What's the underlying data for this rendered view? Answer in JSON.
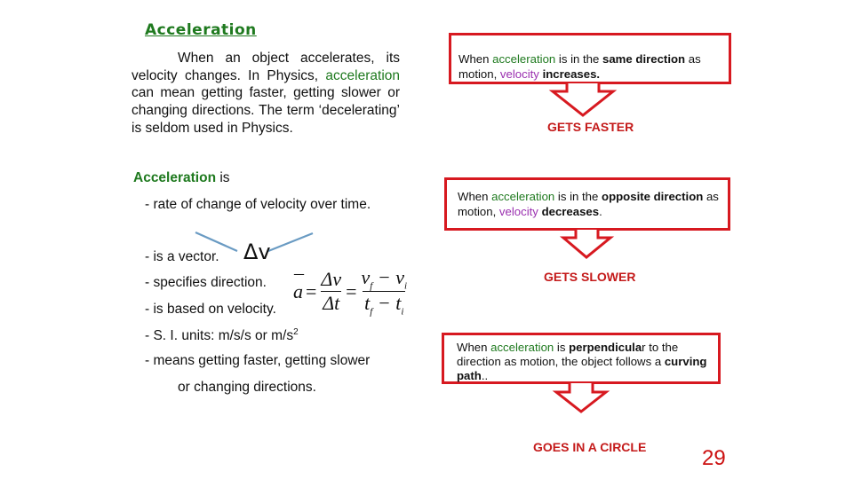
{
  "left": {
    "title": "Acceleration",
    "intro": {
      "p1": "When an object accelerates, its velocity changes. In Physics, ",
      "highlight": "acceleration",
      "p2": " can mean getting faster, getting slower or changing directions. The term ‘decelerating’ is seldom used in Physics."
    },
    "definition": {
      "head_green": "Acceleration",
      "head_rest": " is",
      "bullets": [
        "- rate of change of velocity over time.",
        "- is a vector.",
        "- specifies direction.",
        "- is based on velocity.",
        "- S. I. units:  m/s/s or m/s",
        "- means getting faster, getting slower",
        "or changing directions."
      ],
      "units_superscript": "2",
      "delta_v": "Δv",
      "formula": {
        "lhs": "a",
        "num1": "Δv",
        "den1": "Δt",
        "num2": "v",
        "num2_sub_f": "f",
        "num2_minus": " − v",
        "num2_sub_i": "i",
        "den2": "t",
        "den2_sub_f": "f",
        "den2_minus": " − t",
        "den2_sub_i": "i"
      }
    }
  },
  "right": {
    "boxes": [
      {
        "t1": "When ",
        "green": "acceleration",
        "t2": " is in the ",
        "bold1": "same direction",
        "t3": " as motion, ",
        "purple": "velocity",
        "t4": " ",
        "bold2": "increases.",
        "t5": "",
        "result": "GETS FASTER"
      },
      {
        "t1": "When ",
        "green": "acceleration",
        "t2": " is in the ",
        "bold1": "opposite direction",
        "t3": " as motion, ",
        "purple": "velocity",
        "t4": " ",
        "bold2": "decreases",
        "t5": ".",
        "result": "GETS SLOWER"
      },
      {
        "t1": "When ",
        "green": "acceleration",
        "t2": " is ",
        "bold1": "perpendicula",
        "t3": "r to the direction as motion,  the object follows a ",
        "bold2": "curving path",
        "t5": "..",
        "result": "GOES IN A CIRCLE"
      }
    ]
  },
  "page_number": "29",
  "colors": {
    "accent_red": "#d71920",
    "green": "#1f7a1f",
    "purple": "#9b30b0",
    "arrow_blue": "#6a9bc3"
  }
}
